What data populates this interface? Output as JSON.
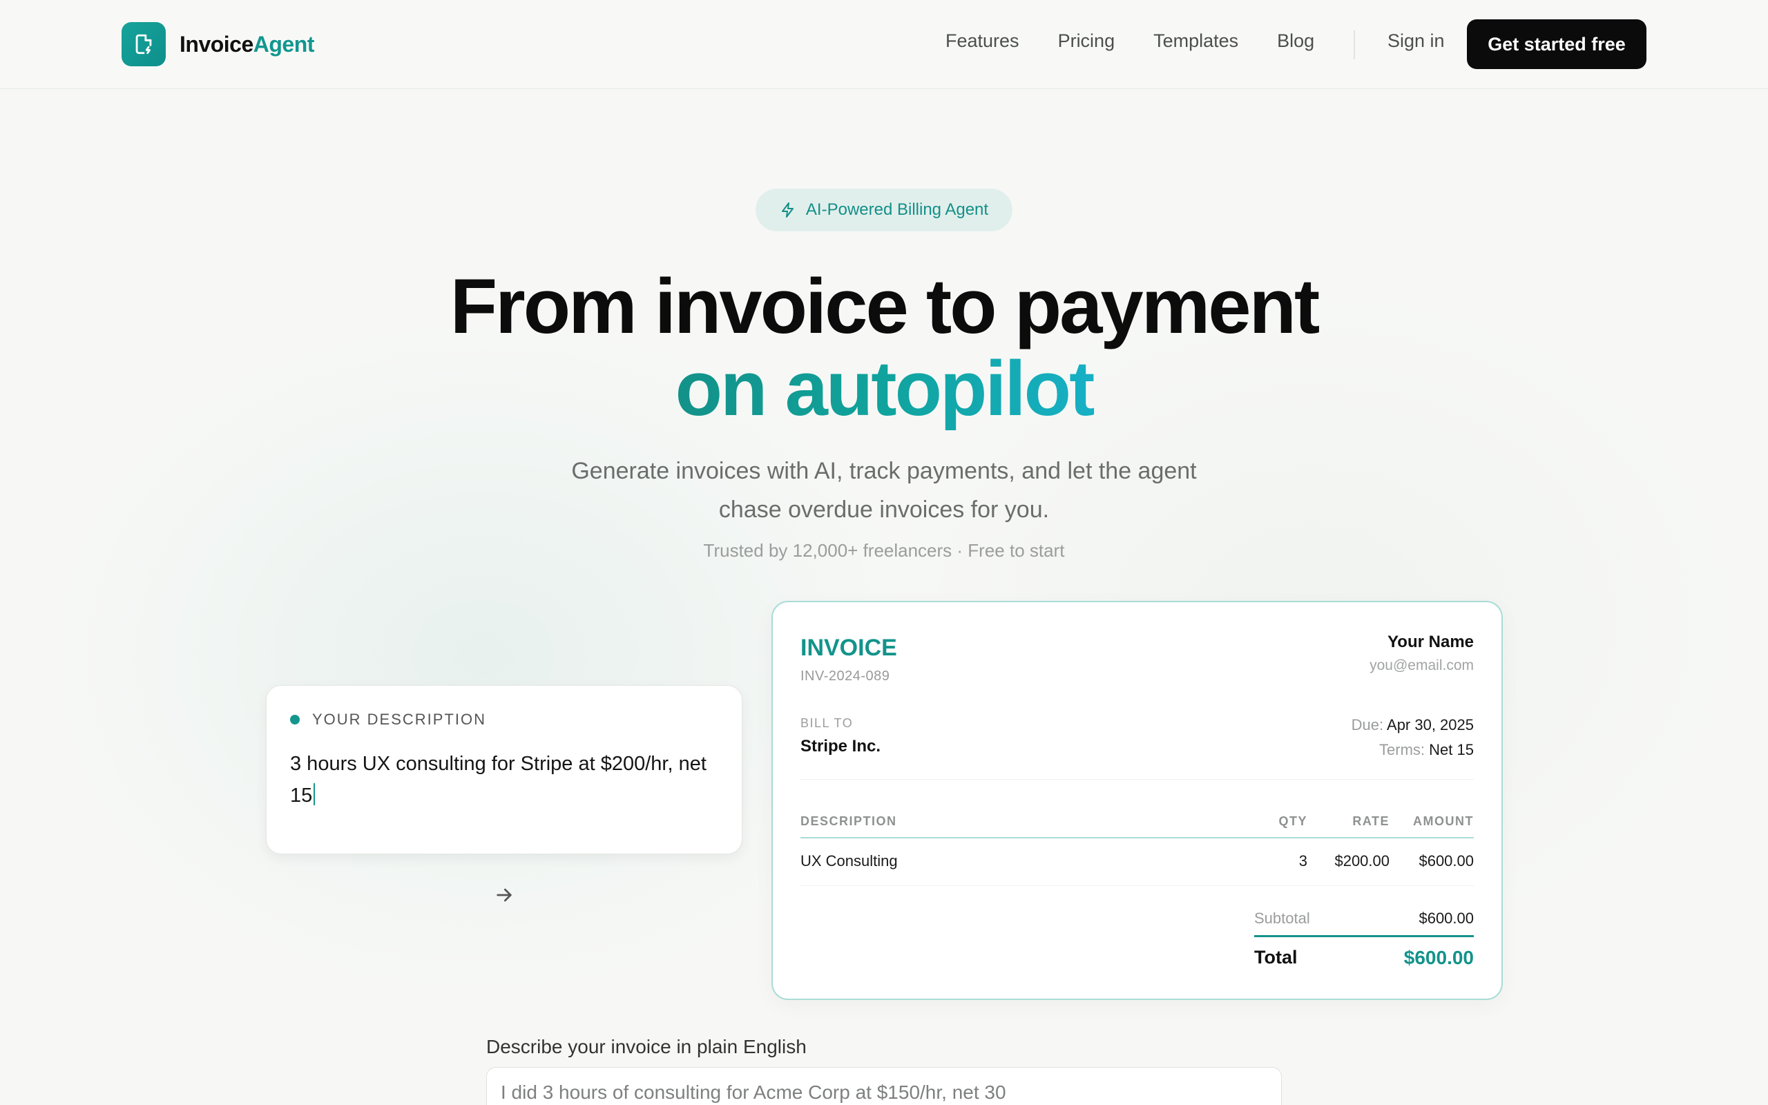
{
  "brand": {
    "name_part1": "Invoice",
    "name_part2": "Agent",
    "logo_icon": "document-bolt-icon",
    "accent": "#13968f"
  },
  "nav": {
    "links": [
      "Features",
      "Pricing",
      "Templates",
      "Blog"
    ],
    "signin": "Sign in",
    "cta": "Get started free"
  },
  "hero": {
    "badge": "AI-Powered Billing Agent",
    "badge_icon": "bolt-icon",
    "title_line1": "From invoice to payment",
    "title_line2": "on autopilot",
    "subtitle_line1": "Generate invoices with AI, track payments, and let the agent",
    "subtitle_line2": "chase overdue invoices for you.",
    "trust": "Trusted by 12,000+ freelancers · Free to start"
  },
  "description_card": {
    "label": "YOUR DESCRIPTION",
    "text": "3 hours UX consulting for Stripe at $200/hr, net 15"
  },
  "invoice": {
    "title": "INVOICE",
    "number": "INV-2024-089",
    "from_name": "Your Name",
    "from_email": "you@email.com",
    "bill_to_label": "BILL TO",
    "bill_to": "Stripe Inc.",
    "due_label": "Due:",
    "due_date": "Apr 30, 2025",
    "terms_label": "Terms:",
    "terms": "Net 15",
    "columns": {
      "description": "DESCRIPTION",
      "qty": "QTY",
      "rate": "RATE",
      "amount": "AMOUNT"
    },
    "line_items": [
      {
        "description": "UX Consulting",
        "qty": "3",
        "rate": "$200.00",
        "amount": "$600.00"
      }
    ],
    "subtotal_label": "Subtotal",
    "subtotal": "$600.00",
    "total_label": "Total",
    "total": "$600.00"
  },
  "prompt": {
    "label": "Describe your invoice in plain English",
    "placeholder": "I did 3 hours of consulting for Acme Corp at $150/hr, net 30"
  }
}
